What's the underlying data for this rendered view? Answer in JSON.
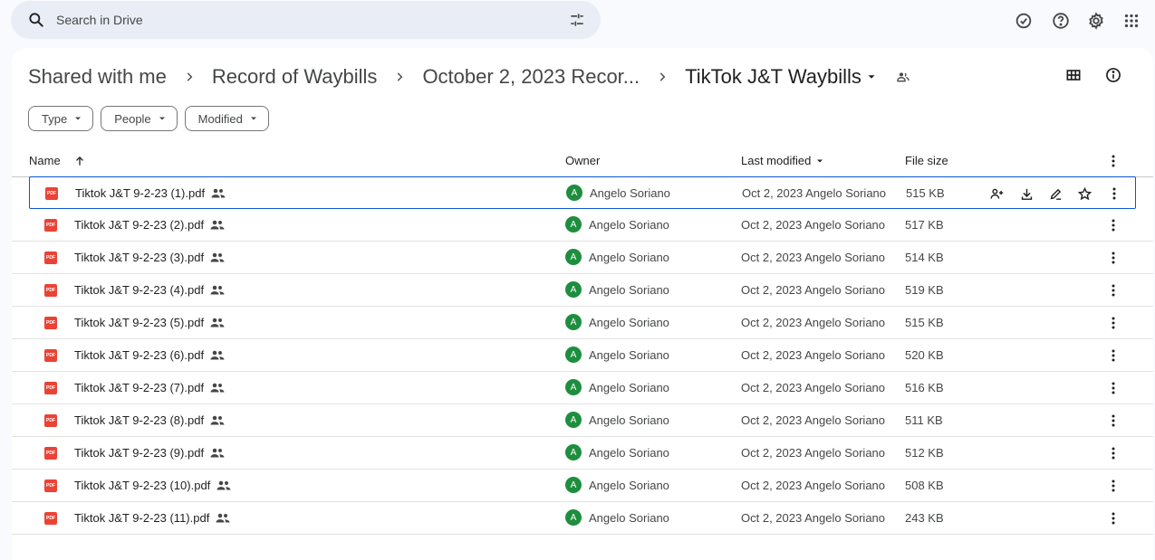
{
  "search": {
    "placeholder": "Search in Drive"
  },
  "icons": {
    "search": "search-icon",
    "tune": "tune-icon",
    "offline": "offline-ready-icon",
    "help": "help-icon",
    "settings": "gear-icon",
    "apps": "apps-grid-icon"
  },
  "breadcrumb": {
    "items": [
      "Shared with me",
      "Record of Waybills",
      "October 2, 2023 Recor...",
      "TikTok J&T Waybills"
    ]
  },
  "filters": [
    "Type",
    "People",
    "Modified"
  ],
  "columns": {
    "name": "Name",
    "owner": "Owner",
    "modified": "Last modified",
    "size": "File size"
  },
  "files": [
    {
      "name": "Tiktok J&T 9-2-23 (1).pdf",
      "owner": "Angelo Soriano",
      "modified": "Oct 2, 2023 Angelo Soriano",
      "size": "515 KB"
    },
    {
      "name": "Tiktok J&T 9-2-23 (2).pdf",
      "owner": "Angelo Soriano",
      "modified": "Oct 2, 2023 Angelo Soriano",
      "size": "517 KB"
    },
    {
      "name": "Tiktok J&T 9-2-23 (3).pdf",
      "owner": "Angelo Soriano",
      "modified": "Oct 2, 2023 Angelo Soriano",
      "size": "514 KB"
    },
    {
      "name": "Tiktok J&T 9-2-23 (4).pdf",
      "owner": "Angelo Soriano",
      "modified": "Oct 2, 2023 Angelo Soriano",
      "size": "519 KB"
    },
    {
      "name": "Tiktok J&T 9-2-23 (5).pdf",
      "owner": "Angelo Soriano",
      "modified": "Oct 2, 2023 Angelo Soriano",
      "size": "515 KB"
    },
    {
      "name": "Tiktok J&T 9-2-23 (6).pdf",
      "owner": "Angelo Soriano",
      "modified": "Oct 2, 2023 Angelo Soriano",
      "size": "520 KB"
    },
    {
      "name": "Tiktok J&T 9-2-23 (7).pdf",
      "owner": "Angelo Soriano",
      "modified": "Oct 2, 2023 Angelo Soriano",
      "size": "516 KB"
    },
    {
      "name": "Tiktok J&T 9-2-23 (8).pdf",
      "owner": "Angelo Soriano",
      "modified": "Oct 2, 2023 Angelo Soriano",
      "size": "511 KB"
    },
    {
      "name": "Tiktok J&T 9-2-23 (9).pdf",
      "owner": "Angelo Soriano",
      "modified": "Oct 2, 2023 Angelo Soriano",
      "size": "512 KB"
    },
    {
      "name": "Tiktok J&T 9-2-23 (10).pdf",
      "owner": "Angelo Soriano",
      "modified": "Oct 2, 2023 Angelo Soriano",
      "size": "508 KB"
    },
    {
      "name": "Tiktok J&T 9-2-23 (11).pdf",
      "owner": "Angelo Soriano",
      "modified": "Oct 2, 2023 Angelo Soriano",
      "size": "243 KB"
    }
  ],
  "avatar_letter": "A",
  "file_badge": "PDF",
  "colors": {
    "accent": "#0b57d0",
    "pdf_red": "#ea4335",
    "avatar_green": "#1e8e3e",
    "search_bg": "#e9eef6",
    "page_bg": "#f8fafd"
  }
}
